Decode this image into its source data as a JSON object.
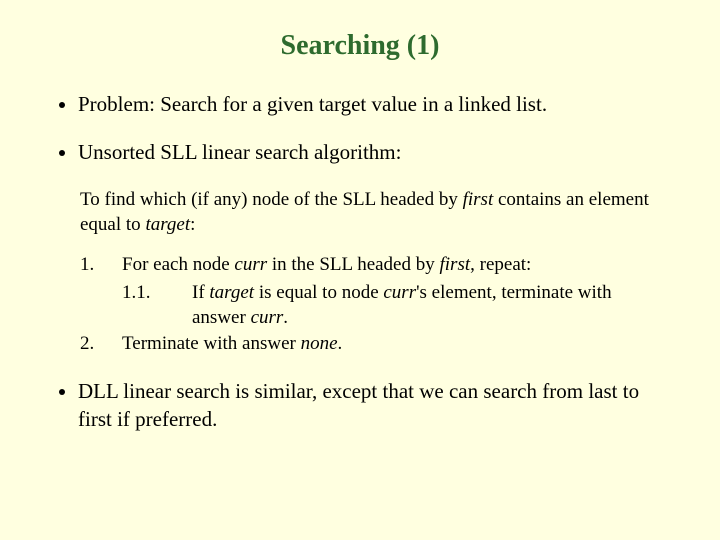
{
  "title": "Searching (1)",
  "bullets": {
    "b1": "Problem: Search for a given target value in a linked list.",
    "b2": "Unsorted SLL linear search algorithm:",
    "b3": "DLL linear search is similar, except that we can search from last to first if preferred."
  },
  "algo": {
    "intro_a": "To find which (if any) node of the SLL headed by ",
    "intro_first": "first",
    "intro_b": " contains an element equal to ",
    "intro_target": "target",
    "intro_c": ":",
    "step1_num": "1.",
    "step1_a": "For each node ",
    "step1_curr": "curr",
    "step1_b": " in the SLL headed by ",
    "step1_first": "first",
    "step1_c": ", repeat:",
    "step11_num": "1.1.",
    "step11_a": "If ",
    "step11_target": "target",
    "step11_b": " is equal to node ",
    "step11_curr": "curr",
    "step11_c": "'s element, terminate with answer ",
    "step11_curr2": "curr",
    "step11_d": ".",
    "step2_num": "2.",
    "step2_a": "Terminate with answer ",
    "step2_none": "none",
    "step2_b": "."
  }
}
